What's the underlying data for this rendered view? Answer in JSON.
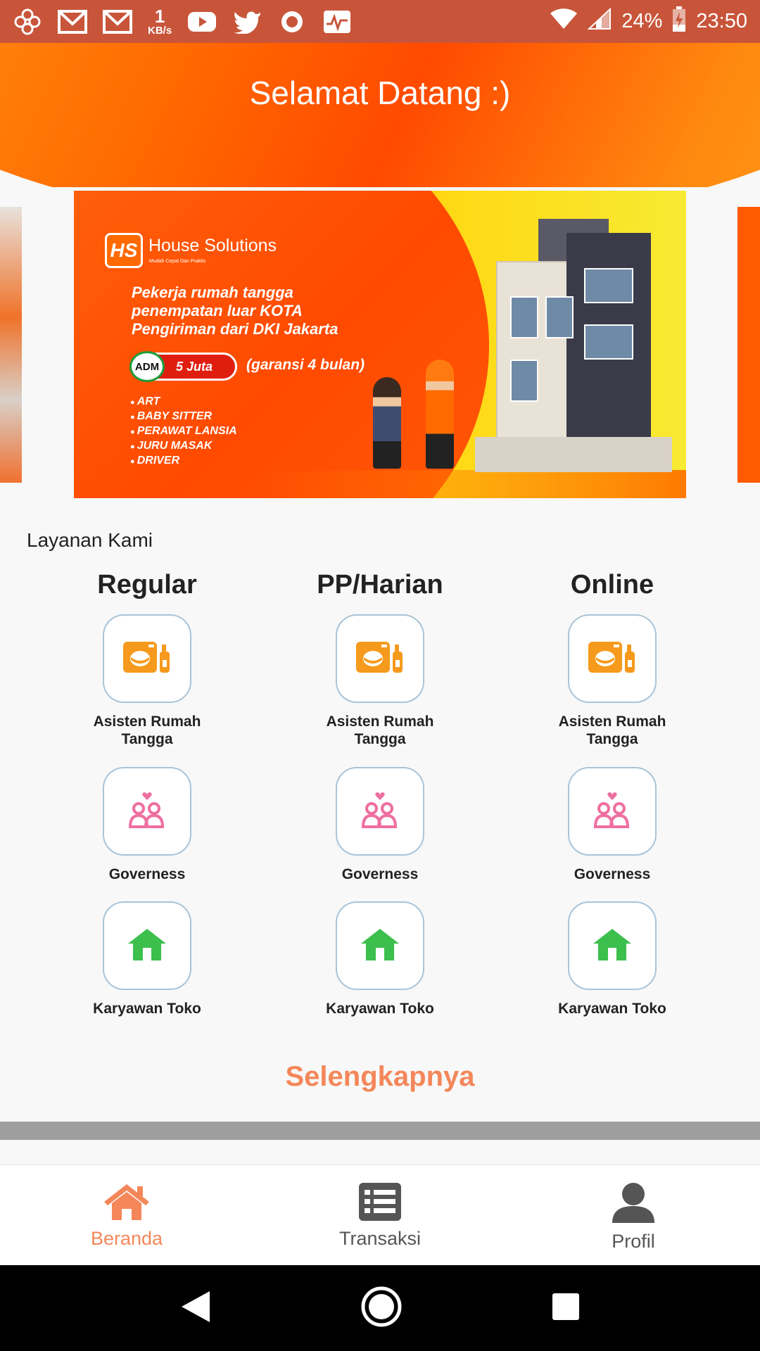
{
  "status_bar": {
    "speed_value": "1",
    "speed_unit": "KB/s",
    "battery": "24%",
    "time": "23:50",
    "icons": [
      "pinwheel-icon",
      "gmail-icon",
      "gmail-icon",
      "youtube-icon",
      "twitter-icon",
      "record-icon",
      "activity-icon",
      "wifi-icon",
      "signal-icon",
      "battery-charging-icon"
    ]
  },
  "header": {
    "title": "Selamat Datang :)"
  },
  "banner": {
    "brand": "House Solutions",
    "tagline": "Mudah Cepat Dan Praktis",
    "lines": [
      "Pekerja rumah tangga",
      "penempatan luar KOTA",
      "Pengiriman dari DKI Jakarta"
    ],
    "adm_label": "ADM",
    "adm_value": "5 Juta",
    "guarantee": "(garansi 4 bulan)",
    "list": [
      "ART",
      "BABY SITTER",
      "PERAWAT LANSIA",
      "JURU MASAK",
      "DRIVER"
    ]
  },
  "services": {
    "title": "Layanan Kami",
    "columns": [
      {
        "heading": "Regular",
        "items": [
          "Asisten Rumah Tangga",
          "Governess",
          "Karyawan Toko"
        ]
      },
      {
        "heading": "PP/Harian",
        "items": [
          "Asisten Rumah Tangga",
          "Governess",
          "Karyawan Toko"
        ]
      },
      {
        "heading": "Online",
        "items": [
          "Asisten Rumah Tangga",
          "Governess",
          "Karyawan Toko"
        ]
      }
    ],
    "more_label": "Selengkapnya"
  },
  "bottom_nav": {
    "items": [
      {
        "label": "Beranda",
        "icon": "home-icon",
        "active": true
      },
      {
        "label": "Transaksi",
        "icon": "list-icon",
        "active": false
      },
      {
        "label": "Profil",
        "icon": "user-icon",
        "active": false
      }
    ]
  },
  "colors": {
    "accent": "#f4875a",
    "status_bar": "#c8553a",
    "header": "#ff6a00",
    "icon_orange": "#f59a1c",
    "icon_pink": "#ee6fa0",
    "icon_green": "#3cbf4c"
  }
}
